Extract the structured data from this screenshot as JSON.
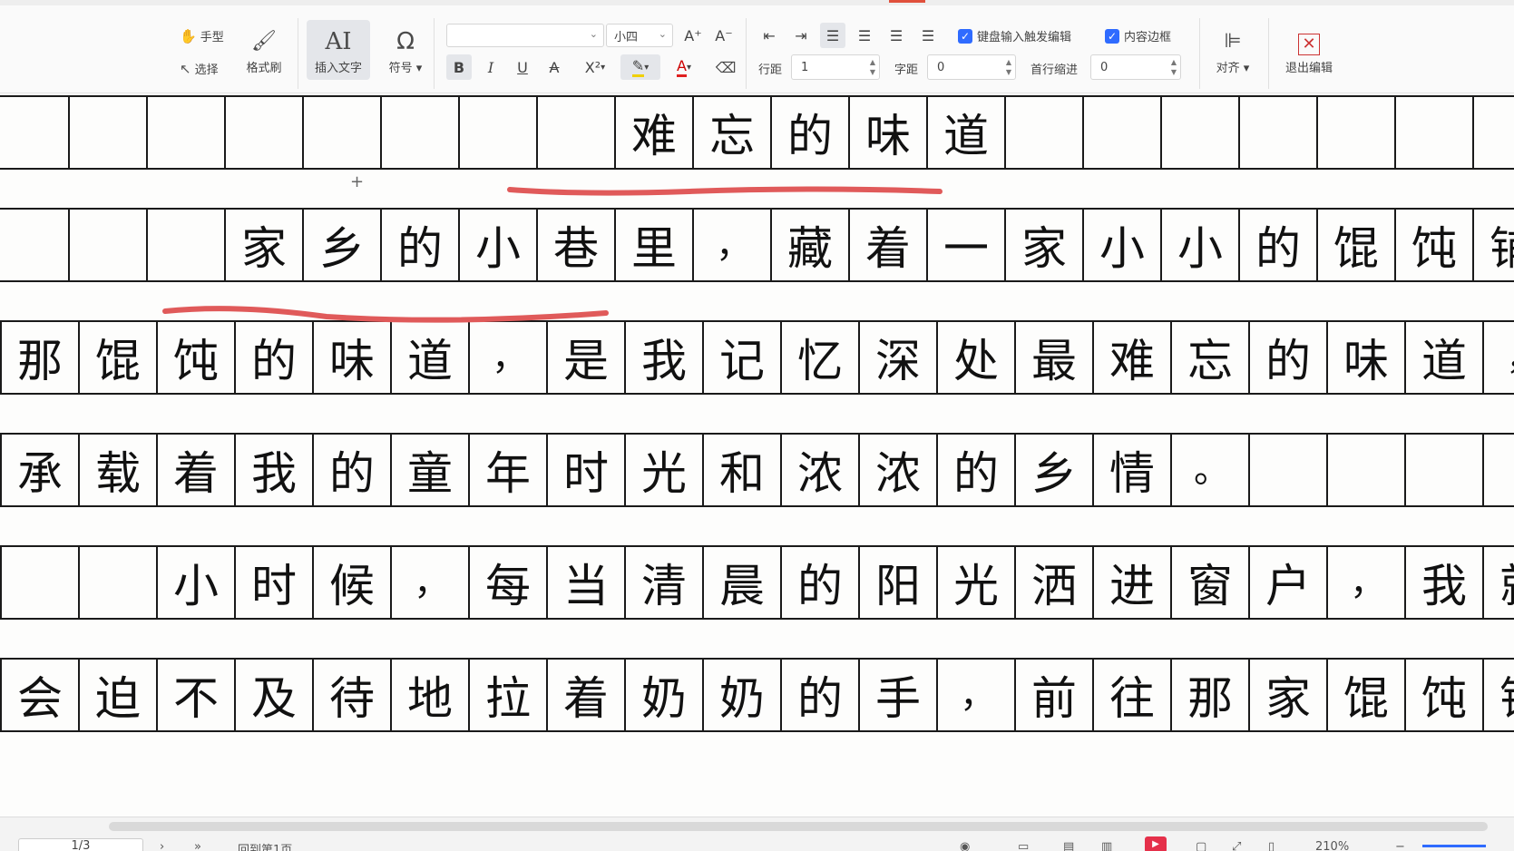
{
  "toolbar": {
    "hand_label": "手型",
    "select_label": "选择",
    "format_painter_label": "格式刷",
    "insert_text_label": "插入文字",
    "symbol_label": "符号",
    "font_name": "",
    "font_size": "小四",
    "line_spacing_label": "行距",
    "line_spacing_value": "1",
    "char_spacing_label": "字距",
    "char_spacing_value": "0",
    "first_indent_label": "首行缩进",
    "first_indent_value": "0",
    "keyboard_edit_label": "键盘输入触发编辑",
    "content_border_label": "内容边框",
    "align_label": "对齐",
    "exit_edit_label": "退出编辑",
    "bold": "B",
    "italic": "I",
    "underline": "U",
    "strike": "A",
    "superscript": "X²",
    "font_color": "A",
    "grow_font": "A⁺",
    "shrink_font": "A⁻"
  },
  "document": {
    "rows": [
      [
        "",
        "",
        "",
        "",
        "",
        "",
        "",
        "难",
        "忘",
        "的",
        "味",
        "道",
        "",
        "",
        "",
        "",
        "",
        "",
        "",
        ""
      ],
      [
        "",
        "",
        "家",
        "乡",
        "的",
        "小",
        "巷",
        "里",
        "，",
        "藏",
        "着",
        "一",
        "家",
        "小",
        "小",
        "的",
        "馄",
        "饨",
        "铺",
        "，"
      ],
      [
        "那",
        "馄",
        "饨",
        "的",
        "味",
        "道",
        "，",
        "是",
        "我",
        "记",
        "忆",
        "深",
        "处",
        "最",
        "难",
        "忘",
        "的",
        "味",
        "道",
        "，"
      ],
      [
        "承",
        "载",
        "着",
        "我",
        "的",
        "童",
        "年",
        "时",
        "光",
        "和",
        "浓",
        "浓",
        "的",
        "乡",
        "情",
        "。",
        "",
        "",
        "",
        ""
      ],
      [
        "",
        "",
        "小",
        "时",
        "候",
        "，",
        "每",
        "当",
        "清",
        "晨",
        "的",
        "阳",
        "光",
        "洒",
        "进",
        "窗",
        "户",
        "，",
        "我",
        "就"
      ],
      [
        "会",
        "迫",
        "不",
        "及",
        "待",
        "地",
        "拉",
        "着",
        "奶",
        "奶",
        "的",
        "手",
        "，",
        "前",
        "往",
        "那",
        "家",
        "馄",
        "饨",
        "铺"
      ]
    ],
    "underline_color": "#e05a5a"
  },
  "statusbar": {
    "page": "1/3",
    "back_to_first": "回到第1页",
    "zoom": "210%"
  },
  "colors": {
    "accent": "#2f6bff",
    "record": "#e5304a"
  }
}
